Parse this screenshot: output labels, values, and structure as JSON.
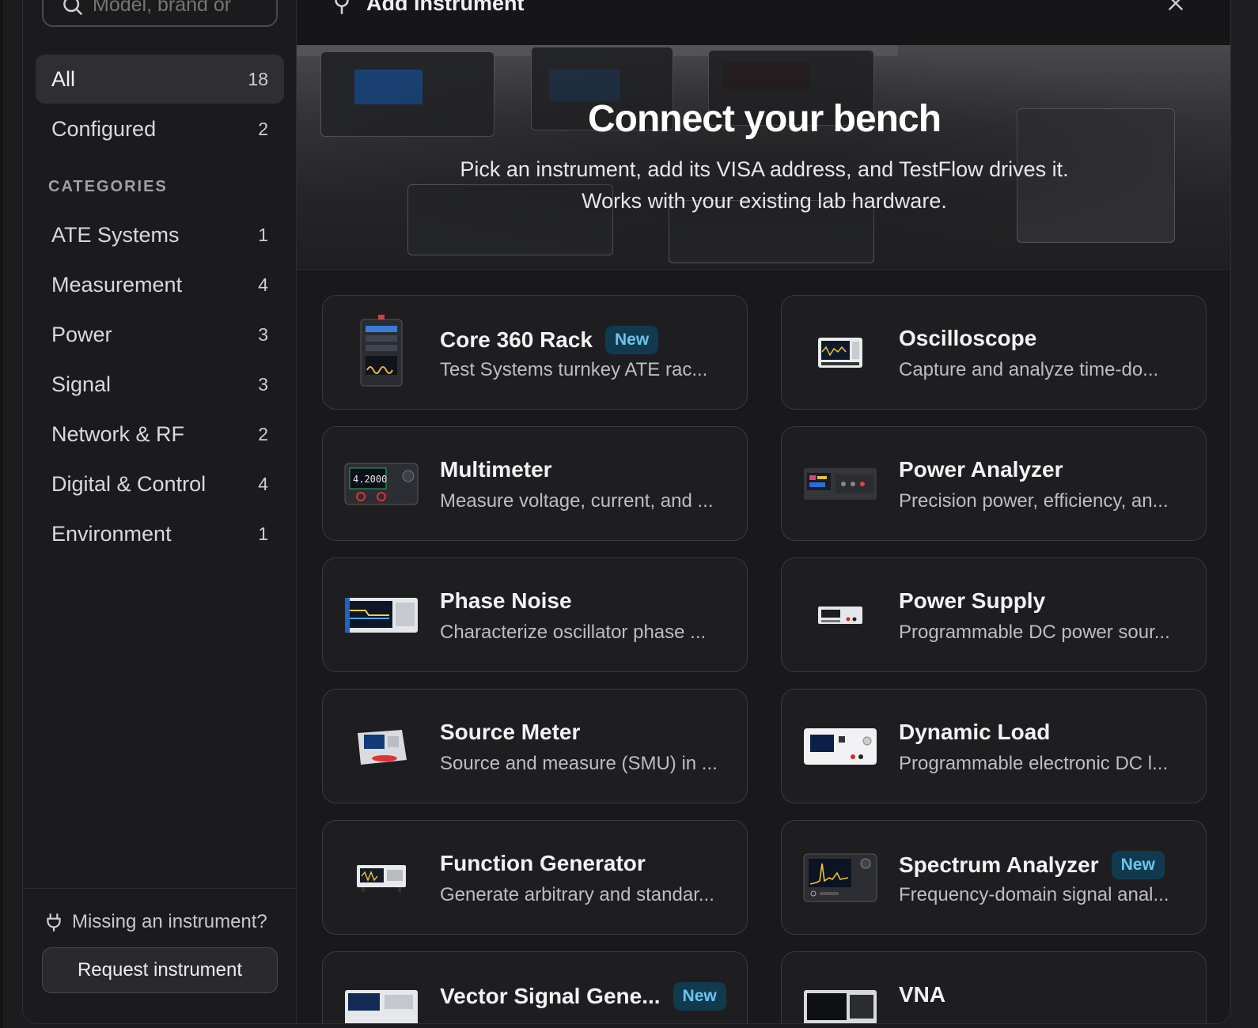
{
  "search": {
    "placeholder": "Model, brand or"
  },
  "nav": {
    "all": {
      "label": "All",
      "count": "18"
    },
    "configured": {
      "label": "Configured",
      "count": "2"
    }
  },
  "categories_label": "CATEGORIES",
  "categories": [
    {
      "label": "ATE Systems",
      "count": "1"
    },
    {
      "label": "Measurement",
      "count": "4"
    },
    {
      "label": "Power",
      "count": "3"
    },
    {
      "label": "Signal",
      "count": "3"
    },
    {
      "label": "Network & RF",
      "count": "2"
    },
    {
      "label": "Digital & Control",
      "count": "4"
    },
    {
      "label": "Environment",
      "count": "1"
    }
  ],
  "footer": {
    "missing_text": "Missing an instrument?",
    "request_label": "Request instrument"
  },
  "dialog": {
    "title": "Add instrument"
  },
  "hero": {
    "title": "Connect your bench",
    "line1": "Pick an instrument, add its VISA address, and TestFlow drives it.",
    "line2": "Works with your existing lab hardware."
  },
  "instruments": [
    {
      "name": "Core 360 Rack",
      "desc": "Test Systems turnkey ATE rac...",
      "badge": "New",
      "icon": "rack-icon"
    },
    {
      "name": "Oscilloscope",
      "desc": "Capture and analyze time-do...",
      "badge": "",
      "icon": "oscilloscope-icon"
    },
    {
      "name": "Multimeter",
      "desc": "Measure voltage, current, and ...",
      "badge": "",
      "icon": "multimeter-icon"
    },
    {
      "name": "Power Analyzer",
      "desc": "Precision power, efficiency, an...",
      "badge": "",
      "icon": "power-analyzer-icon"
    },
    {
      "name": "Phase Noise",
      "desc": "Characterize oscillator phase ...",
      "badge": "",
      "icon": "phase-noise-icon"
    },
    {
      "name": "Power Supply",
      "desc": "Programmable DC power sour...",
      "badge": "",
      "icon": "power-supply-icon"
    },
    {
      "name": "Source Meter",
      "desc": "Source and measure (SMU) in ...",
      "badge": "",
      "icon": "source-meter-icon"
    },
    {
      "name": "Dynamic Load",
      "desc": "Programmable electronic DC l...",
      "badge": "",
      "icon": "dynamic-load-icon"
    },
    {
      "name": "Function Generator",
      "desc": "Generate arbitrary and standar...",
      "badge": "",
      "icon": "function-generator-icon"
    },
    {
      "name": "Spectrum Analyzer",
      "desc": "Frequency-domain signal anal...",
      "badge": "New",
      "icon": "spectrum-analyzer-icon"
    },
    {
      "name": "Vector Signal Gene...",
      "desc": "",
      "badge": "New",
      "icon": "vector-signal-generator-icon"
    },
    {
      "name": "VNA",
      "desc": "",
      "badge": "",
      "icon": "vna-icon"
    }
  ],
  "colors": {
    "accent_badge_bg": "#123a4f",
    "accent_badge_text": "#6cc4ee",
    "screen_blue": "#1b4f8f"
  }
}
